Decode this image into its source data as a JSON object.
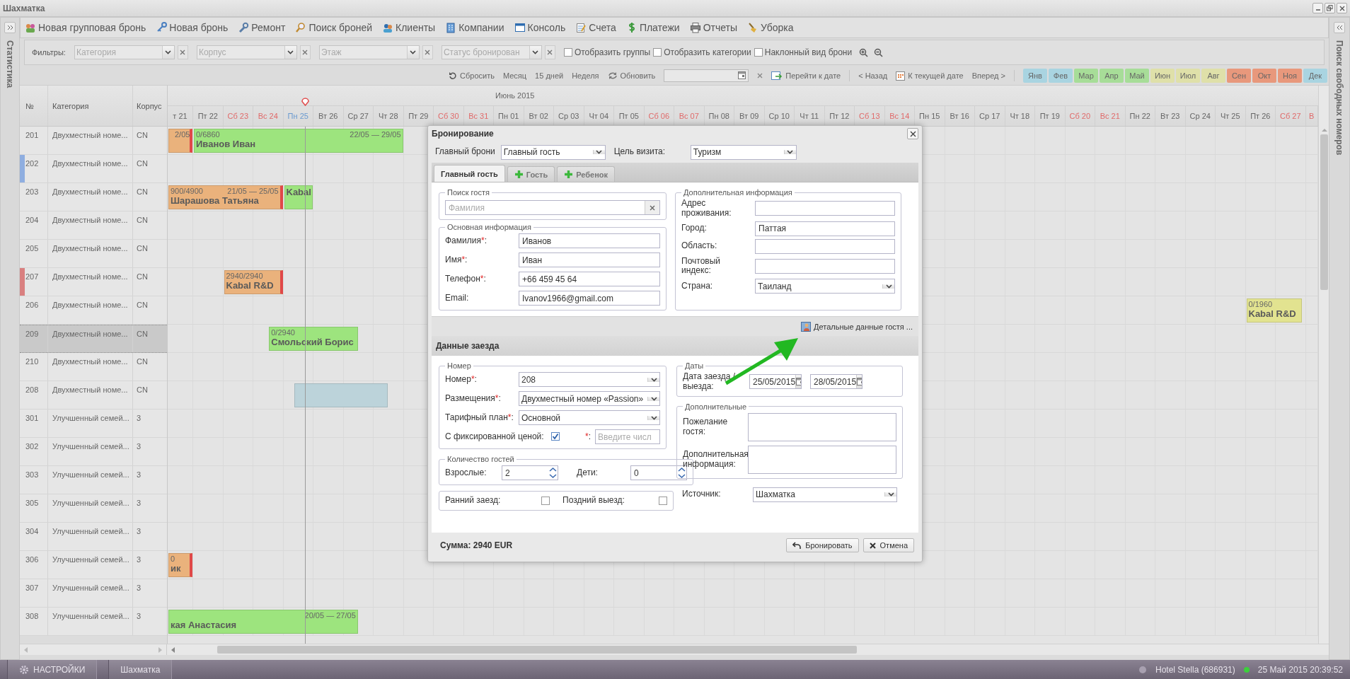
{
  "window": {
    "title": "Шахматка"
  },
  "left_panel": {
    "title": "Статистика"
  },
  "right_panel": {
    "title": "Поиск свободных номеров"
  },
  "toolbar": [
    {
      "label": "Новая групповая бронь"
    },
    {
      "label": "Новая бронь"
    },
    {
      "label": "Ремонт"
    },
    {
      "label": "Поиск броней"
    },
    {
      "label": "Клиенты"
    },
    {
      "label": "Компании"
    },
    {
      "label": "Консоль"
    },
    {
      "label": "Счета"
    },
    {
      "label": "Платежи"
    },
    {
      "label": "Отчеты"
    },
    {
      "label": "Уборка"
    }
  ],
  "filters": {
    "label": "Фильтры:",
    "combos": [
      {
        "placeholder": "Категория"
      },
      {
        "placeholder": "Корпус"
      },
      {
        "placeholder": "Этаж"
      },
      {
        "placeholder": "Статус бронирован"
      }
    ],
    "checkboxes": [
      {
        "label": "Отобразить группы",
        "checked": false
      },
      {
        "label": "Отобразить категории",
        "checked": false
      },
      {
        "label": "Наклонный вид брони",
        "checked": false
      }
    ]
  },
  "nav": {
    "reset": "Сбросить",
    "views": [
      "Месяц",
      "15 дней",
      "Неделя"
    ],
    "refresh": "Обновить",
    "goto": "Перейти к дате",
    "back": "< Назад",
    "today": "К текущей дате",
    "forward": "Вперед >",
    "months": [
      {
        "label": "Янв",
        "color": "#a9d4e1"
      },
      {
        "label": "Фев",
        "color": "#a9d4e1"
      },
      {
        "label": "Мар",
        "color": "#a7dd98"
      },
      {
        "label": "Апр",
        "color": "#a7dd98"
      },
      {
        "label": "Май",
        "color": "#a7dd98"
      },
      {
        "label": "Июн",
        "color": "#dfe0a9"
      },
      {
        "label": "Июл",
        "color": "#dfe0a9"
      },
      {
        "label": "Авг",
        "color": "#dfe0a9"
      },
      {
        "label": "Сен",
        "color": "#e8987c"
      },
      {
        "label": "Окт",
        "color": "#e8987c"
      },
      {
        "label": "Ноя",
        "color": "#e8987c"
      },
      {
        "label": "Дек",
        "color": "#a9d4e1"
      }
    ]
  },
  "grid": {
    "columns": [
      "№",
      "Категория",
      "Корпус"
    ],
    "month": "Июнь 2015",
    "days": [
      {
        "label": "т 21",
        "kind": "workday"
      },
      {
        "label": "Пт 22",
        "kind": "workday"
      },
      {
        "label": "Сб 23",
        "kind": "weekend"
      },
      {
        "label": "Вс 24",
        "kind": "weekend"
      },
      {
        "label": "Пн 25",
        "kind": "today"
      },
      {
        "label": "Вт 26",
        "kind": "workday"
      },
      {
        "label": "Ср 27",
        "kind": "workday"
      },
      {
        "label": "Чт 28",
        "kind": "workday"
      },
      {
        "label": "Пт 29",
        "kind": "workday"
      },
      {
        "label": "Сб 30",
        "kind": "weekend"
      },
      {
        "label": "Вс 31",
        "kind": "weekend"
      },
      {
        "label": "Пн 01",
        "kind": "workday"
      },
      {
        "label": "Вт 02",
        "kind": "workday"
      },
      {
        "label": "Ср 03",
        "kind": "workday"
      },
      {
        "label": "Чт 04",
        "kind": "workday"
      },
      {
        "label": "Пт 05",
        "kind": "workday"
      },
      {
        "label": "Сб 06",
        "kind": "weekend"
      },
      {
        "label": "Вс 07",
        "kind": "weekend"
      },
      {
        "label": "Пн 08",
        "kind": "workday"
      },
      {
        "label": "Вт 09",
        "kind": "workday"
      },
      {
        "label": "Ср 10",
        "kind": "workday"
      },
      {
        "label": "Чт 11",
        "kind": "workday"
      },
      {
        "label": "Пт 12",
        "kind": "workday"
      },
      {
        "label": "Сб 13",
        "kind": "weekend"
      },
      {
        "label": "Вс 14",
        "kind": "weekend"
      },
      {
        "label": "Пн 15",
        "kind": "workday"
      },
      {
        "label": "Вт 16",
        "kind": "workday"
      },
      {
        "label": "Ср 17",
        "kind": "workday"
      },
      {
        "label": "Чт 18",
        "kind": "workday"
      },
      {
        "label": "Пт 19",
        "kind": "workday"
      },
      {
        "label": "Сб 20",
        "kind": "weekend"
      },
      {
        "label": "Вс 21",
        "kind": "weekend"
      },
      {
        "label": "Пн 22",
        "kind": "workday"
      },
      {
        "label": "Вт 23",
        "kind": "workday"
      },
      {
        "label": "Ср 24",
        "kind": "workday"
      },
      {
        "label": "Чт 25",
        "kind": "workday"
      },
      {
        "label": "Пт 26",
        "kind": "workday"
      },
      {
        "label": "Сб 27",
        "kind": "weekend"
      },
      {
        "label": "В",
        "kind": "weekend"
      }
    ],
    "rows": [
      {
        "number": "201",
        "category": "Двухместный номе...",
        "building": "CN",
        "selected": false
      },
      {
        "number": "202",
        "category": "Двухместный номе...",
        "building": "CN",
        "selected": false,
        "color": "#8faee0"
      },
      {
        "number": "203",
        "category": "Двухместный номе...",
        "building": "CN",
        "selected": false
      },
      {
        "number": "204",
        "category": "Двухместный номе...",
        "building": "CN",
        "selected": false
      },
      {
        "number": "205",
        "category": "Двухместный номе...",
        "building": "CN",
        "selected": false
      },
      {
        "number": "207",
        "category": "Двухместный номе...",
        "building": "CN",
        "selected": false,
        "color": "#d98080"
      },
      {
        "number": "206",
        "category": "Двухместный номе...",
        "building": "CN",
        "selected": false
      },
      {
        "number": "209",
        "category": "Двухместный номе...",
        "building": "CN",
        "selected": true
      },
      {
        "number": "210",
        "category": "Двухместный номе...",
        "building": "CN",
        "selected": false
      },
      {
        "number": "208",
        "category": "Двухместный номе...",
        "building": "CN",
        "selected": false
      },
      {
        "number": "301",
        "category": "Улучшенный семей...",
        "building": "3",
        "selected": false
      },
      {
        "number": "302",
        "category": "Улучшенный семей...",
        "building": "3",
        "selected": false
      },
      {
        "number": "303",
        "category": "Улучшенный семей...",
        "building": "3",
        "selected": false
      },
      {
        "number": "305",
        "category": "Улучшенный семей...",
        "building": "3",
        "selected": false
      },
      {
        "number": "304",
        "category": "Улучшенный семей...",
        "building": "3",
        "selected": false
      },
      {
        "number": "306",
        "category": "Улучшенный семей...",
        "building": "3",
        "selected": false
      },
      {
        "number": "307",
        "category": "Улучшенный семей...",
        "building": "3",
        "selected": false
      },
      {
        "number": "308",
        "category": "Улучшенный семей...",
        "building": "3",
        "selected": false
      }
    ],
    "bookings": [
      {
        "kind": "booking",
        "color": "#eab27c",
        "end_mark": true,
        "dates": "2/05"
      },
      {
        "kind": "booking",
        "color": "#9de47e",
        "end_mark": false,
        "amount": "0/6860",
        "dates": "22/05 — 29/05",
        "guest": "Иванов Иван"
      },
      {
        "kind": "booking",
        "color": "#eab27c",
        "end_mark": true,
        "amount": "900/4900",
        "dates": "21/05 — 25/05",
        "guest": "Шарашова Татьяна"
      },
      {
        "kind": "booking",
        "color": "#9de47e",
        "end_mark": false,
        "guest": "Kabal"
      },
      {
        "kind": "booking",
        "color": "#eab27c",
        "end_mark": true,
        "amount": "2940/2940",
        "guest": "Kabal R&D"
      },
      {
        "kind": "booking",
        "color": "#9de47e",
        "end_mark": false,
        "amount": "0/2940",
        "guest": "Смольский Борис"
      },
      {
        "kind": "selection",
        "color": "#bcd3da"
      },
      {
        "kind": "booking",
        "color": "#eab27c",
        "end_mark": true,
        "amount": "0",
        "guest": "ик"
      },
      {
        "kind": "booking",
        "color": "#9de47e",
        "end_mark": false,
        "dates": "20/05 — 27/05",
        "guest": "кая Анастасия"
      },
      {
        "kind": "booking",
        "color": "#e2e390",
        "end_mark": false,
        "amount": "0/1960",
        "guest": "Kabal R&D"
      }
    ]
  },
  "dialog": {
    "title": "Бронирование",
    "main_booking": {
      "label": "Главный брони",
      "value": "Главный гость"
    },
    "purpose": {
      "label": "Цель визита:",
      "value": "Туризм"
    },
    "tabs": [
      {
        "label": "Главный гость",
        "selected": true,
        "kind": "plain"
      },
      {
        "label": "Гость",
        "selected": false,
        "kind": "add"
      },
      {
        "label": "Ребенок",
        "selected": false,
        "kind": "add"
      }
    ],
    "guest_search": {
      "legend": "Поиск гостя",
      "placeholder": "Фамилия"
    },
    "main_info": {
      "legend": "Основная информация",
      "fields": [
        {
          "label": "Фамилия",
          "mark": "*",
          "tail": ":",
          "value": "Иванов"
        },
        {
          "label": "Имя",
          "mark": "*",
          "tail": ":",
          "value": "Иван"
        },
        {
          "label": "Телефон",
          "mark": "*",
          "tail": ":",
          "value": "+66 459 45 64"
        },
        {
          "label": "Email:",
          "value": "Ivanov1966@gmail.com"
        }
      ]
    },
    "extra_info": {
      "legend": "Дополнительная информация",
      "fields": [
        {
          "label": "Адрес проживания:",
          "kind": "text"
        },
        {
          "label": "Город:",
          "kind": "text",
          "value": "Паттая"
        },
        {
          "label": "Область:",
          "kind": "text"
        },
        {
          "label": "Почтовый индекс:",
          "kind": "text"
        },
        {
          "label": "Страна:",
          "kind": "combo",
          "value": "Таиланд"
        }
      ]
    },
    "details_link": "Детальные данные гостя ...",
    "stay_title": "Данные заезда",
    "room": {
      "legend": "Номер",
      "fields": [
        {
          "label": "Номер",
          "mark": "*",
          "tail": ":",
          "value": "208"
        },
        {
          "label": "Размещения",
          "mark": "*",
          "tail": ":",
          "value": "Двухместный номер «Passion»"
        },
        {
          "label": "Тарифный план",
          "mark": "*",
          "tail": ":",
          "value": "Основной"
        }
      ],
      "fixed_price": {
        "label": "С фиксированной ценой:",
        "checked": true
      },
      "price": {
        "mark": "*",
        "tail": ":",
        "placeholder": "Введите числ"
      }
    },
    "guests": {
      "legend": "Количество гостей",
      "adults": {
        "label": "Взрослые:",
        "value": "2"
      },
      "children": {
        "label": "Дети:",
        "value": "0"
      }
    },
    "early_checkin": {
      "label": "Ранний заезд:",
      "checked": false
    },
    "late_checkout": {
      "label": "Поздний выезд:",
      "checked": false
    },
    "dates": {
      "legend": "Даты",
      "label": "Дата заезда / выезда:",
      "from": "25/05/2015",
      "to": "28/05/2015"
    },
    "additional": {
      "legend": "Дополнительные",
      "fields": [
        {
          "label": "Пожелание гостя:"
        },
        {
          "label": "Дополнительная информация:"
        }
      ]
    },
    "source": {
      "label": "Источник:",
      "value": "Шахматка"
    },
    "total": "Сумма: 2940 EUR",
    "buttons": [
      {
        "label": "Бронировать",
        "kind": "book"
      },
      {
        "label": "Отмена",
        "kind": "cancel"
      }
    ]
  },
  "taskbar": {
    "settings": "НАСТРОЙКИ",
    "tabs": [
      "Шахматка"
    ],
    "hotel": "Hotel Stella (686931)",
    "datetime": "25 Май 2015 20:39:52"
  }
}
